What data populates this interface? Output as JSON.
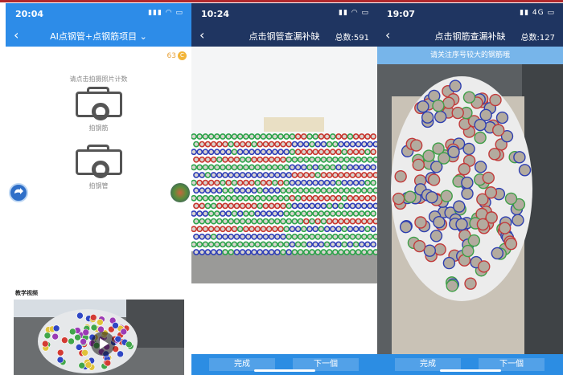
{
  "screens": [
    {
      "time": "20:04",
      "title": "AI点钢管+点钢筋项目",
      "coins": "63",
      "hint": "请点击拍摄照片计数",
      "camera1_label": "拍钢筋",
      "camera2_label": "拍钢管",
      "video_section_title": "教学视频"
    },
    {
      "time": "10:24",
      "title": "点击钢管查漏补缺",
      "count": "总数:591",
      "done_button": "完成",
      "next_button": "下一個"
    },
    {
      "time": "19:07",
      "network": "4G",
      "title": "点击钢筋查漏补缺",
      "count": "总数:127",
      "notice": "请关注序号较大的钢筋哦",
      "done_button": "完成",
      "next_button": "下一個"
    }
  ],
  "colors": {
    "primary_blue": "#2d8ce8",
    "dark_navy": "#1f3561",
    "notice_blue": "#77b5ea",
    "coin_gold": "#f2b53a"
  }
}
